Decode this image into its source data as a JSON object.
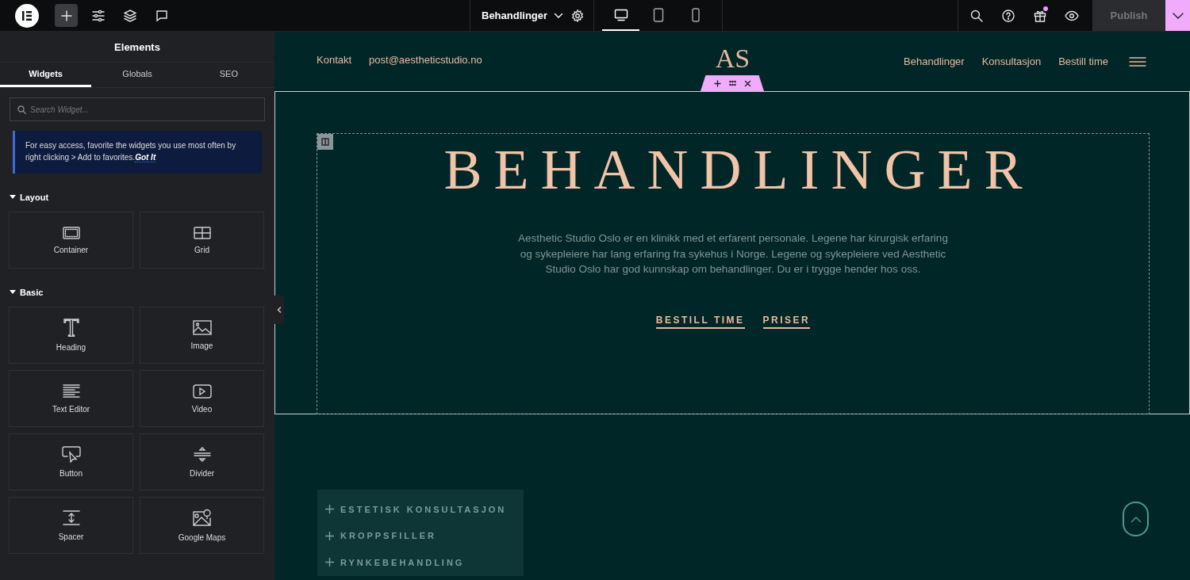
{
  "topbar": {
    "left_tools": [
      {
        "kind": "logo"
      },
      {
        "kind": "add",
        "selected": true
      },
      {
        "kind": "settings",
        "selected": false
      },
      {
        "kind": "layers",
        "selected": false
      },
      {
        "kind": "comments",
        "selected": false
      }
    ],
    "page_title": "Behandlinger",
    "devices": [
      {
        "kind": "desktop",
        "selected": true
      },
      {
        "kind": "tablet",
        "selected": false
      },
      {
        "kind": "mobile",
        "selected": false
      }
    ],
    "right_tools": [
      {
        "kind": "search"
      },
      {
        "kind": "help"
      },
      {
        "kind": "gift",
        "notification": true
      },
      {
        "kind": "preview"
      }
    ],
    "publish": {
      "label": "Publish",
      "disabled": true
    }
  },
  "panel": {
    "title": "Elements",
    "tabs": [
      {
        "label": "Widgets",
        "selected": true
      },
      {
        "label": "Globals",
        "selected": false
      },
      {
        "label": "SEO",
        "selected": false
      }
    ],
    "search": {
      "placeholder": "Search Widget..."
    },
    "notice": {
      "text": "For easy access, favorite the widgets you use most often by right clicking > Add to favorites.",
      "link": "Got It"
    },
    "sections": [
      {
        "title": "Layout",
        "expanded": true,
        "widgets": [
          {
            "label": "Container",
            "kind": "container"
          },
          {
            "label": "Grid",
            "kind": "grid"
          }
        ]
      },
      {
        "title": "Basic",
        "expanded": true,
        "widgets": [
          {
            "label": "Heading",
            "kind": "heading"
          },
          {
            "label": "Image",
            "kind": "image"
          },
          {
            "label": "Text Editor",
            "kind": "text"
          },
          {
            "label": "Video",
            "kind": "video"
          },
          {
            "label": "Button",
            "kind": "button"
          },
          {
            "label": "Divider",
            "kind": "divider"
          },
          {
            "label": "Spacer",
            "kind": "spacer"
          },
          {
            "label": "Google Maps",
            "kind": "map"
          }
        ]
      }
    ]
  },
  "site": {
    "header_left": [
      "Kontakt",
      "post@aestheticstudio.no"
    ],
    "logo": "AS",
    "nav": [
      "Behandlinger",
      "Konsultasjon",
      "Bestill time"
    ],
    "hero": {
      "heading": "BEHANDLINGER",
      "text": "Aesthetic Studio Oslo er en klinikk med et erfarent personale. Legene har kirurgisk erfaring og sykepleiere har lang erfaring fra sykehus i Norge. Legene og sykepleiere ved Aesthetic Studio Oslo har god kunnskap om behandlinger. Du er i trygge hender hos oss.",
      "links": [
        "BESTILL TIME",
        "PRISER"
      ]
    },
    "accordion": [
      {
        "title": "ESTETISK KONSULTASJON",
        "expanded": false
      },
      {
        "title": "KROPPSFILLER",
        "expanded": false
      },
      {
        "title": "RYNKEBEHANDLING",
        "expanded": false
      }
    ]
  }
}
